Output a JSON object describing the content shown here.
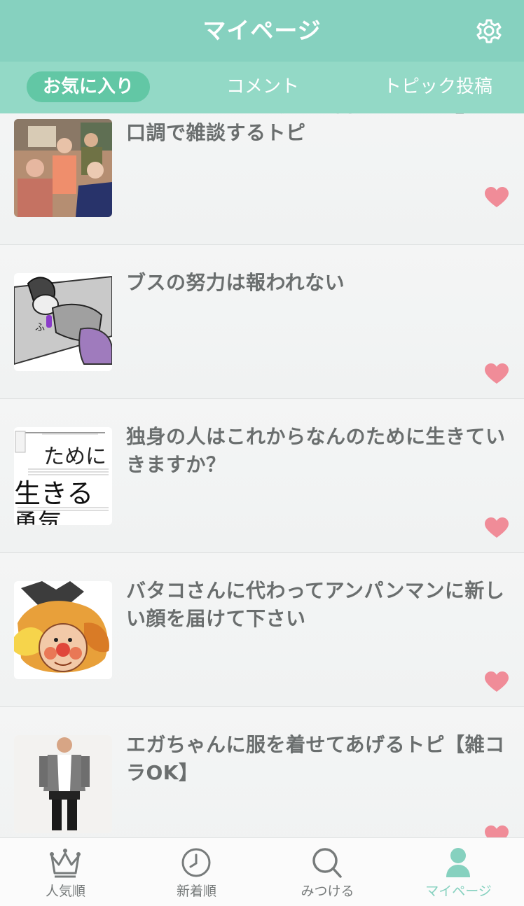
{
  "header": {
    "title": "マイページ",
    "settings_icon": "gear-icon"
  },
  "tabs": [
    {
      "label": "お気に入り",
      "active": true
    },
    {
      "label": "コメント",
      "active": false
    },
    {
      "label": "トピック投稿",
      "active": false
    }
  ],
  "favorites": [
    {
      "title": "【こしらえる】『渡る世間は鬼ばかり』の口調で雑談するトピ",
      "thumbnail": "photo of family drama cast",
      "favorited": true
    },
    {
      "title": "ブスの努力は報われない",
      "thumbnail": "sketch of sleeping woman",
      "favorited": true
    },
    {
      "title": "独身の人はこれからなんのために生きていきますか？",
      "thumbnail": "book cover",
      "favorited": true
    },
    {
      "title": "バタコさんに代わってアンパンマンに新しい顔を届けて下さい",
      "thumbnail": "anime collage with anpanman face",
      "favorited": true
    },
    {
      "title": "エガちゃんに服を着せてあげるトピ【雑コラOK】",
      "thumbnail": "photo of man in cardigan",
      "favorited": true
    }
  ],
  "bottom_nav": [
    {
      "label": "人気順",
      "icon": "crown-icon",
      "active": false
    },
    {
      "label": "新着順",
      "icon": "clock-icon",
      "active": false
    },
    {
      "label": "みつける",
      "icon": "search-icon",
      "active": false
    },
    {
      "label": "マイページ",
      "icon": "person-icon",
      "active": true
    }
  ],
  "colors": {
    "header": "#86d1bf",
    "tabbar": "#93d9c6",
    "active_tab": "#62c7a5",
    "heart": "#f08c98",
    "text": "#6a6e6e"
  }
}
